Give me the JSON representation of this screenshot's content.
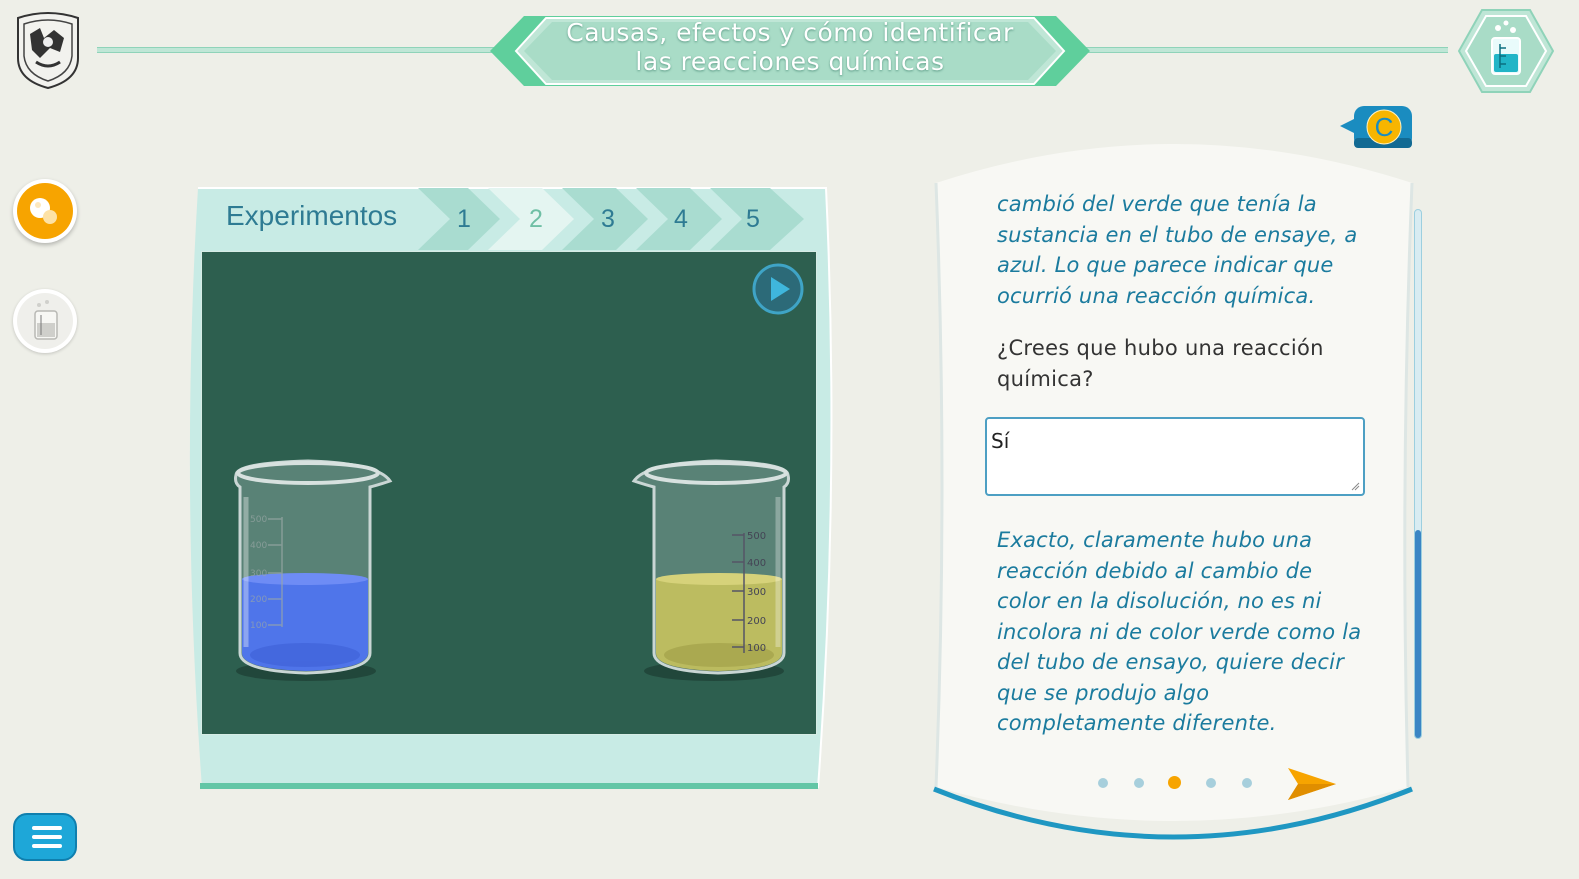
{
  "header": {
    "title_line1": "Causas, efectos y cómo identificar",
    "title_line2": "las reacciones químicas"
  },
  "experiments": {
    "label": "Experimentos",
    "steps": [
      "1",
      "2",
      "3",
      "4",
      "5"
    ],
    "active_step": "2"
  },
  "beakers": {
    "left": {
      "liquid_color": "#4f74f0",
      "scale": [
        "500",
        "400",
        "300",
        "200",
        "100"
      ]
    },
    "right": {
      "liquid_color": "#c4c15e",
      "scale": [
        "500",
        "400",
        "300",
        "200",
        "100"
      ]
    }
  },
  "card": {
    "badge": "C",
    "text1": "cambió del verde que tenía la sustancia en el tubo de ensaye, a azul. Lo que parece indicar que ocurrió una reacción química.",
    "question": "¿Crees que hubo una reacción química?",
    "answer_value": "Sí",
    "feedback": "Exacto, claramente hubo una reacción debido al cambio de color en la disolución, no es ni incolora ni de color verde como la del tubo de ensayo, quiere decir que se produjo algo completamente diferente.",
    "pagination": {
      "total": 5,
      "current": 3
    }
  },
  "colors": {
    "accent_green": "#5fcf9c",
    "accent_blue": "#1b7b9e",
    "accent_orange": "#f7a400",
    "stage_bg": "#2d5f4f"
  }
}
